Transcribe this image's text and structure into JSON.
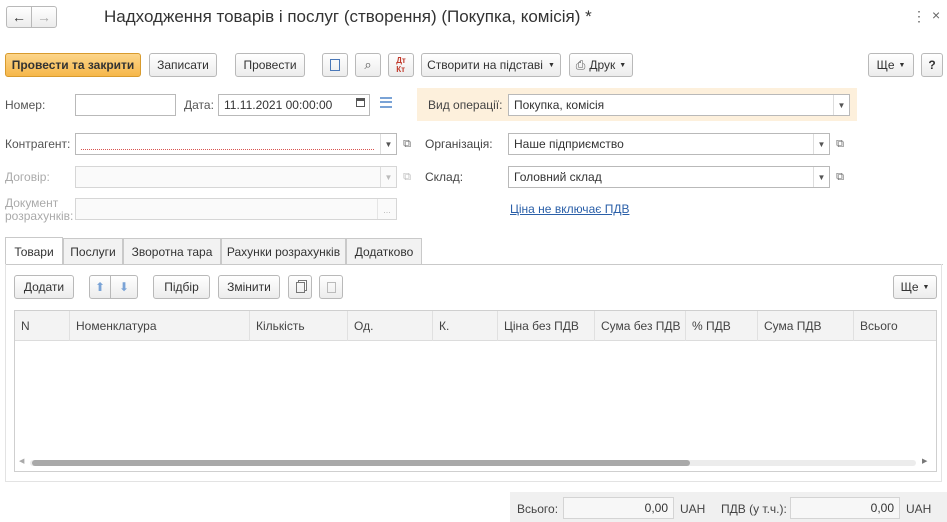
{
  "header": {
    "back_icon": "arrow-left-icon",
    "forward_icon": "arrow-right-icon",
    "title": "Надходження товарів і послуг (створення) (Покупка, комісія) *",
    "menu_icon": "kebab-menu-icon",
    "close_icon": "close-icon"
  },
  "toolbar": {
    "post_close": "Провести та закрити",
    "write": "Записати",
    "post": "Провести",
    "create_based": "Створити на підставі",
    "print": "Друк",
    "more": "Ще",
    "help": "?"
  },
  "form": {
    "number_label": "Номер:",
    "number_value": "",
    "date_label": "Дата:",
    "date_value": "11.11.2021 00:00:00",
    "operation_label": "Вид операції:",
    "operation_value": "Покупка, комісія",
    "counterparty_label": "Контрагент:",
    "counterparty_value": "",
    "organization_label": "Організація:",
    "organization_value": "Наше підприємство",
    "contract_label": "Договір:",
    "contract_value": "",
    "warehouse_label": "Склад:",
    "warehouse_value": "Головний склад",
    "settlement_doc_label_1": "Документ",
    "settlement_doc_label_2": "розрахунків:",
    "vat_link": "Ціна не включає ПДВ"
  },
  "tabs": [
    {
      "label": "Товари",
      "active": true
    },
    {
      "label": "Послуги",
      "active": false
    },
    {
      "label": "Зворотна тара",
      "active": false
    },
    {
      "label": "Рахунки розрахунків",
      "active": false
    },
    {
      "label": "Додатково",
      "active": false
    }
  ],
  "table_toolbar": {
    "add": "Додати",
    "selection": "Підбір",
    "change": "Змінити",
    "more": "Ще"
  },
  "table": {
    "columns": [
      "N",
      "Номенклатура",
      "Кількість",
      "Од.",
      "К.",
      "Ціна без ПДВ",
      "Сума без ПДВ",
      "% ПДВ",
      "Сума ПДВ",
      "Всього"
    ],
    "rows": []
  },
  "totals": {
    "total_label": "Всього:",
    "total_value": "0,00",
    "total_currency": "UAH",
    "vat_label": "ПДВ (у т.ч.):",
    "vat_value": "0,00",
    "vat_currency": "UAH"
  }
}
